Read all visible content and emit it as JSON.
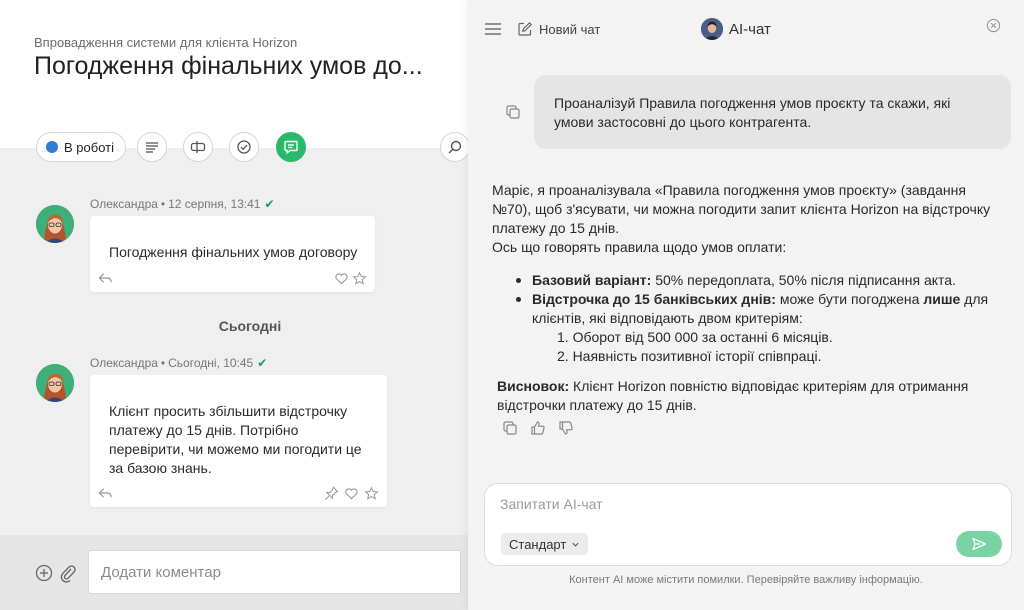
{
  "task": {
    "breadcrumb": "Впровадження системи для клієнта Horizon",
    "title": "Погодження фінальних умов до..."
  },
  "toolbar": {
    "status_label": "В роботі",
    "status_color": "#2f7dd3"
  },
  "feed": {
    "messages": [
      {
        "author": "Олександра",
        "time": "12 серпня, 13:41",
        "text": "Погодження фінальних умов договору"
      },
      {
        "author": "Олександра",
        "time": "Сьогодні, 10:45",
        "text": "Клієнт просить збільшити відстрочку платежу до 15 днів. Потрібно перевірити, чи можемо ми погодити це за базою знань."
      }
    ],
    "day_separator": "Сьогодні"
  },
  "comment": {
    "placeholder": "Додати коментар"
  },
  "ai": {
    "new_chat": "Новий чат",
    "title": "AI-чат",
    "user_message": "Проаналізуй Правила погодження умов проєкту та скажи, які умови застосовні до цього контрагента.",
    "answer": {
      "intro1": "Маріє, я проаналізувала «Правила погодження умов проєкту» (завдання №70), щоб з'ясувати, чи можна погодити запит клієнта Horizon на відстрочку платежу до 15 днів.",
      "intro2": "Ось що говорять правила щодо умов оплати:",
      "b1_bold": "Базовий варіант:",
      "b1_text": " 50% передоплата, 50% після підписання акта.",
      "b2_bold": "Відстрочка до 15 банківських днів:",
      "b2_text1": " може бути погоджена ",
      "b2_bold2": "лише",
      "b2_text2": " для клієнтів, які відповідають двом критеріям:",
      "c1": "1. Оборот від 500 000 за останні 6 місяців.",
      "c2": "2. Наявність позитивної історії співпраці.",
      "concl_bold": "Висновок:",
      "concl_text": " Клієнт Horizon повністю відповідає критеріям для отримання відстрочки платежу до 15 днів."
    },
    "composer_placeholder": "Запитати AI-чат",
    "mode": "Стандарт",
    "disclaimer": "Контент AI може містити помилки. Перевіряйте важливу інформацію.",
    "accent": "#28b96a"
  }
}
